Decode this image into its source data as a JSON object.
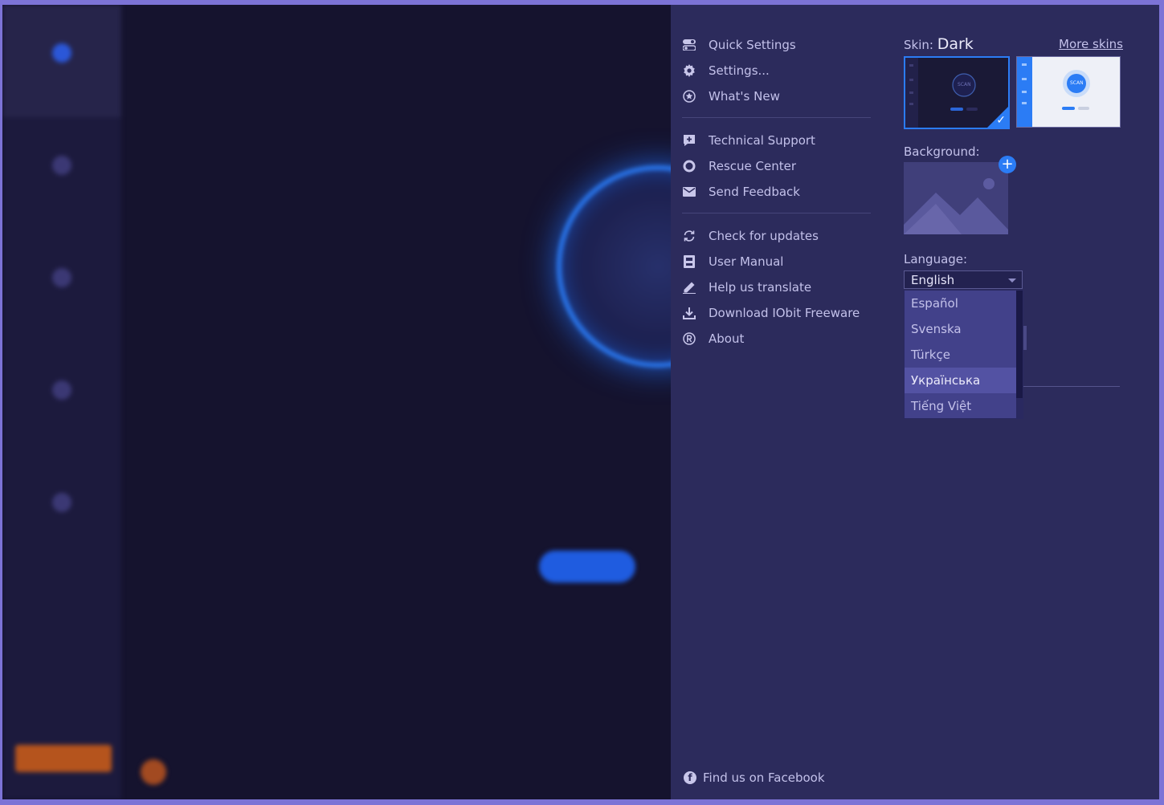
{
  "menu": {
    "items": [
      {
        "label": "Quick Settings",
        "icon": "toggle-icon"
      },
      {
        "label": "Settings...",
        "icon": "gear-icon"
      },
      {
        "label": "What's New",
        "icon": "star-icon"
      },
      {
        "label": "Technical Support",
        "icon": "support-icon"
      },
      {
        "label": "Rescue Center",
        "icon": "lifebuoy-icon"
      },
      {
        "label": "Send Feedback",
        "icon": "mail-icon"
      },
      {
        "label": "Check for updates",
        "icon": "refresh-icon"
      },
      {
        "label": "User Manual",
        "icon": "book-icon"
      },
      {
        "label": "Help us translate",
        "icon": "pencil-icon"
      },
      {
        "label": "Download IObit Freeware",
        "icon": "download-icon"
      },
      {
        "label": "About",
        "icon": "registered-icon"
      }
    ],
    "facebook_label": "Find us on Facebook"
  },
  "skin": {
    "label": "Skin:",
    "current": "Dark",
    "more_label": "More skins",
    "thumb_dark_scan": "SCAN",
    "thumb_light_scan": "SCAN"
  },
  "background": {
    "label": "Background:"
  },
  "language": {
    "label": "Language:",
    "selected": "English",
    "options": [
      "Español",
      "Svenska",
      "Türkçe",
      "Українська",
      "Tiếng Việt"
    ],
    "highlighted": "Українська"
  },
  "colors": {
    "accent": "#2b7cf5",
    "panel": "#2c2b5c",
    "app_bg": "#15132e"
  }
}
